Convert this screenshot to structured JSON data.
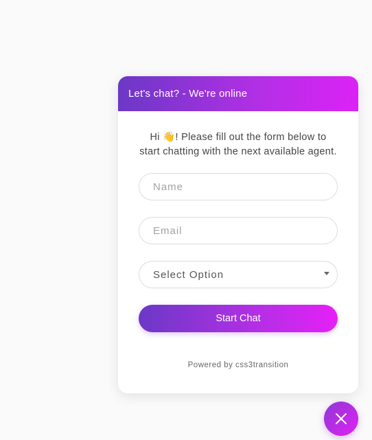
{
  "chat": {
    "header_title": "Let's chat? - We're online",
    "intro_text": "Hi 👋! Please fill out the form below to start chatting with the next available agent.",
    "name_placeholder": "Name",
    "email_placeholder": "Email",
    "select_selected": "Select Option",
    "start_button_label": "Start Chat",
    "powered_by": "Powered by css3transition"
  },
  "icons": {
    "close": "close-icon",
    "dropdown": "chevron-down-icon"
  },
  "colors": {
    "gradient_start": "#6b38c6",
    "gradient_end": "#dc22f6",
    "page_background": "#fafafa"
  }
}
